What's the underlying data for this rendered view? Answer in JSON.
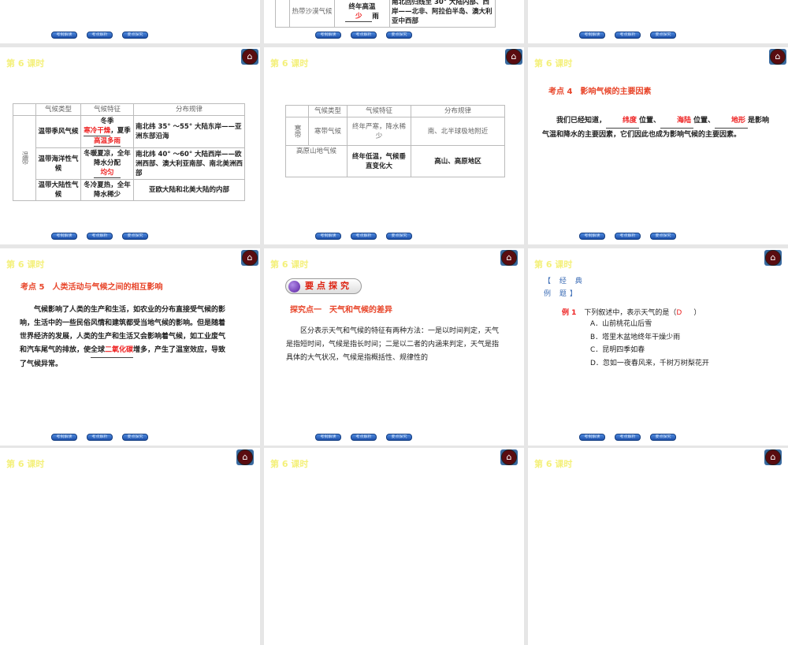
{
  "lesson_label": "第 6 课时",
  "home_icon": "home-icon",
  "nav_buttons": [
    "考纲解读",
    "考点解析",
    "要点探究"
  ],
  "slide_top_mid": {
    "type": "热带沙漠气候",
    "feature_prefix": "终年高温",
    "feature_blank": "少",
    "feature_suffix": "雨",
    "distribution": "南北回归线至 30° 大陆内部、西岸——北非、阿拉伯半岛、澳大利亚中西部"
  },
  "slide_temperate": {
    "headers": [
      "气候类型",
      "气候特征",
      "分布规律"
    ],
    "zone": "温带",
    "rows": [
      {
        "type": "温带季风气候",
        "f1": "冬季",
        "b1": "寒冷干燥",
        "f2": "，夏季",
        "b2": "高温多雨",
        "dist": "南北纬 35° ～55° 大陆东岸——亚洲东部沿海"
      },
      {
        "type": "温带海洋性气候",
        "f1": "冬暖夏凉，全年降水分配",
        "b1": "均匀",
        "dist": "南北纬 40° ～60° 大陆西岸——欧洲西部、澳大利亚南部、南北美洲西部"
      },
      {
        "type": "温带大陆性气候",
        "f1": "冬冷夏热，全年降水稀少",
        "dist": "亚欧大陆和北美大陆的内部"
      }
    ]
  },
  "slide_cold": {
    "headers": [
      "气候类型",
      "气候特征",
      "分布规律"
    ],
    "zone": "寒带",
    "rows": [
      {
        "type": "寒带气候",
        "feature": "终年严寒，降水稀少",
        "dist": "南、北半球极地附近"
      },
      {
        "type": "高原山地气候",
        "feature": "终年低温，气候垂直变化大",
        "dist": "高山、高原地区"
      }
    ]
  },
  "slide_factor": {
    "title": "考点 4　影响气候的主要因素",
    "p1": "我们已经知道，",
    "blank1": "纬度",
    "p2": "位置、",
    "blank2": "海陆",
    "p3": "位置、",
    "blank3": "地形",
    "p4": "是影响气温和降水的主要因素，它们因此也成为影响气候的主要因素。"
  },
  "slide_human": {
    "title": "考点 5　人类活动与气候之间的相互影响",
    "p1": "气候影响了人类的生产和生活，如农业的分布直接受气候的影响，生活中的一些民俗风情和建筑都受当地气候的影响。但是随着世界经济的发展，人类的生产和生活又会影响着气候，如工业废气和汽车尾气的排放，使全球",
    "blank": "二氧化碳",
    "p2": "增多，产生了温室效应，导致了气候异常。"
  },
  "slide_explore": {
    "badge": "要点探究",
    "title": "探究点一　天气和气候的差异",
    "text": "区分表示天气和气候的特征有两种方法：一是以时间判定，天气是指短时间，气候是指长时间；二是以二者的内涵来判定，天气是指具体的大气状况，气候是指概括性、规律性的"
  },
  "slide_example": {
    "heading": "【 经 典 例 题】",
    "label": "例 1",
    "question": "下列叙述中，表示天气的是（",
    "answer": "D",
    "close": "）",
    "options": [
      "A．山前桃花山后雪",
      "B．塔里木盆地终年干燥少雨",
      "C．昆明四季如春",
      "D．忽如一夜春风来，千树万树梨花开"
    ]
  }
}
